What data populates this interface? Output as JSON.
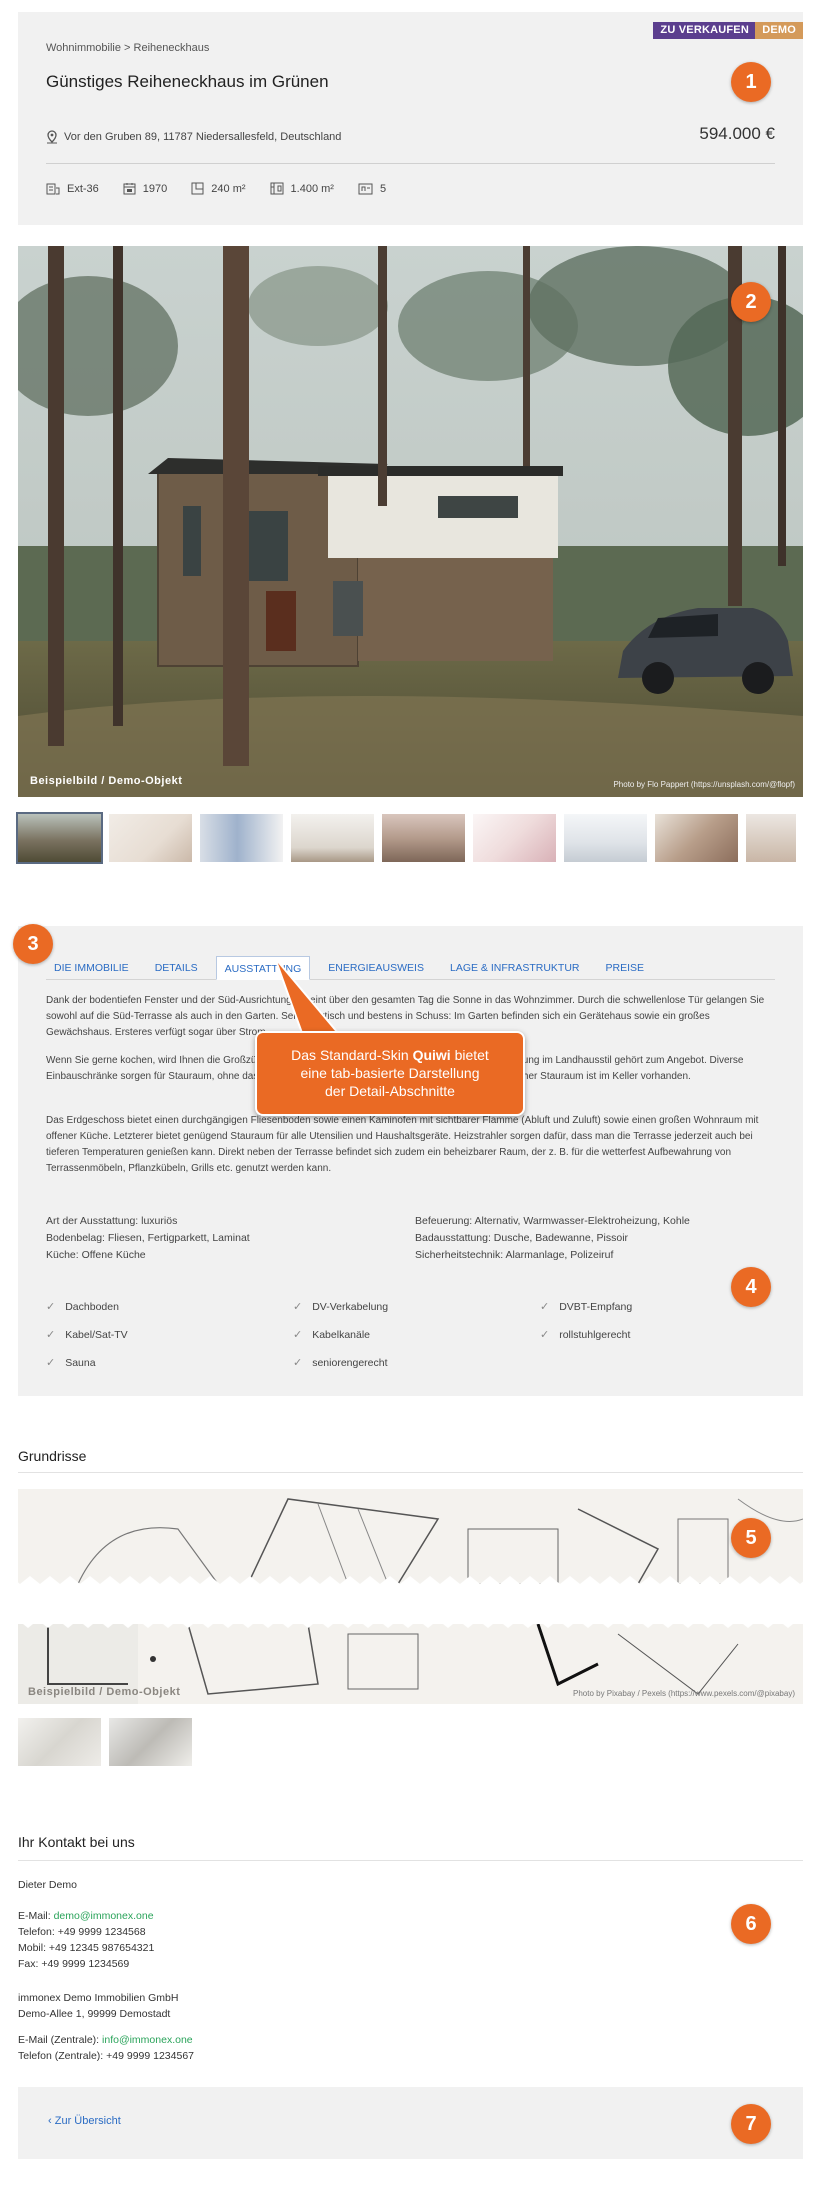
{
  "header": {
    "badge_sale": "ZU VERKAUFEN",
    "badge_demo": "DEMO",
    "breadcrumb": "Wohnimmobilie > Reiheneckhaus",
    "title": "Günstiges Reiheneckhaus im Grünen",
    "address": "Vor den Gruben 89, 11787 Niedersallesfeld, Deutschland",
    "price": "594.000 €",
    "facts": [
      {
        "icon": "building-id-icon",
        "value": "Ext-36"
      },
      {
        "icon": "calendar-icon",
        "value": "1970"
      },
      {
        "icon": "floor-area-icon",
        "value": "240 m²"
      },
      {
        "icon": "plot-area-icon",
        "value": "1.400 m²"
      },
      {
        "icon": "rooms-icon",
        "value": "5"
      }
    ]
  },
  "markers": [
    "1",
    "2",
    "3",
    "4",
    "5",
    "6",
    "7"
  ],
  "photo": {
    "caption": "Beispielbild / Demo-Objekt",
    "credit": "Photo by Flo Pappert (https://unsplash.com/@flopf)"
  },
  "gallery_count": 9,
  "tabs": [
    "DIE IMMOBILIE",
    "DETAILS",
    "AUSSTATTUNG",
    "ENERGIEAUSWEIS",
    "LAGE & INFRASTRUKTUR",
    "PREISE"
  ],
  "active_tab": "AUSSTATTUNG",
  "ausstattung": {
    "p1": "Dank der bodentiefen Fenster und der Süd-Ausrichtung scheint über den gesamten Tag die Sonne in das Wohnzimmer. Durch die schwellenlose Tür gelangen Sie sowohl auf die Süd-Terrasse als auch in den Garten. Sehr praktisch und bestens in Schuss: Im Garten befinden sich ein Gerätehaus sowie ein großes Gewächshaus. Ersteres verfügt sogar über Strom.",
    "p2": "Wenn Sie gerne kochen, wird Ihnen die Großzügigkeit der Küche gefallen. Eine hochwertige Kücheneinrichtung im Landhausstil gehört zum Angebot. Diverse Einbauschränke sorgen für Stauraum, ohne dass die Innenarchitektur unterbrochen werden muss. Zusätzlicher Stauraum ist im Keller vorhanden.",
    "p3": "Das Erdgeschoss bietet einen durchgängigen Fliesenboden sowie einen Kaminofen mit sichtbarer Flamme (Abluft und Zuluft) sowie einen großen Wohnraum mit offener Küche. Letzterer bietet genügend Stauraum für alle Utensilien und Haushaltsgeräte. Heizstrahler sorgen dafür, dass man die Terrasse jederzeit auch bei tieferen Temperaturen genießen kann. Direkt neben der Terrasse befindet sich zudem ein beheizbarer Raum, der z. B. für die wetterfest Aufbewahrung von Terrassenmöbeln, Pflanzkübeln, Grills etc. genutzt werden kann.",
    "attrs_left": [
      "Art der Ausstattung: luxuriös",
      "Bodenbelag: Fliesen, Fertigparkett, Laminat",
      "Küche: Offene Küche"
    ],
    "attrs_right": [
      "Befeuerung: Alternativ, Warmwasser-Elektroheizung, Kohle",
      "Badausstattung: Dusche, Badewanne, Pissoir",
      "Sicherheitstechnik: Alarmanlage, Polizeiruf"
    ],
    "features": [
      "Dachboden",
      "DV-Verkabelung",
      "DVBT-Empfang",
      "Kabel/Sat-TV",
      "Kabelkanäle",
      "rollstuhlgerecht",
      "Sauna",
      "seniorengerecht"
    ]
  },
  "callout": {
    "line1_pre": "Das Standard-Skin ",
    "line1_bold": "Quiwi",
    "line1_post": " bietet",
    "line2": "eine tab-basierte Darstellung",
    "line3": "der Detail-Abschnitte"
  },
  "floorplans": {
    "heading": "Grundrisse",
    "caption": "Beispielbild / Demo-Objekt",
    "credit": "Photo by Pixabay / Pexels (https://www.pexels.com/@pixabay)"
  },
  "contact": {
    "heading": "Ihr Kontakt bei uns",
    "name": "Dieter Demo",
    "email_label": "E-Mail: ",
    "email": "demo@immonex.one",
    "phone": "Telefon: +49 9999 1234568",
    "mobile": "Mobil: +49 12345 987654321",
    "fax": "Fax: +49 9999 1234569",
    "company": "immonex Demo Immobilien GmbH",
    "street": "Demo-Allee 1, 99999 Demostadt",
    "email_central_label": "E-Mail (Zentrale): ",
    "email_central": "info@immonex.one",
    "phone_central": "Telefon (Zentrale): +49 9999 1234567"
  },
  "back_link": "Zur Übersicht",
  "colors": {
    "accent": "#ea6a24",
    "link": "#2b6cc4",
    "badge_sale": "#5b3e8e",
    "badge_demo": "#d49a5a"
  }
}
